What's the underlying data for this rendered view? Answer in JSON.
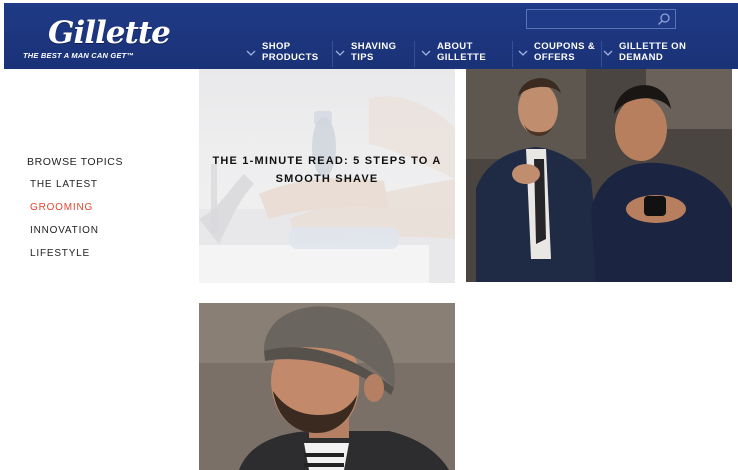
{
  "header": {
    "logo": "Gillette",
    "tagline": "THE BEST A MAN CAN GET™",
    "search_placeholder": "",
    "nav": [
      {
        "label": "SHOP\nPRODUCTS"
      },
      {
        "label": "SHAVING\nTIPS"
      },
      {
        "label": "ABOUT\nGILLETTE"
      },
      {
        "label": "COUPONS &\nOFFERS"
      },
      {
        "label": "GILLETTE ON\nDEMAND"
      }
    ]
  },
  "sidebar": {
    "heading": "BROWSE TOPICS",
    "topics": [
      {
        "label": "THE LATEST"
      },
      {
        "label": "GROOMING"
      },
      {
        "label": "INNOVATION"
      },
      {
        "label": "LIFESTYLE"
      }
    ]
  },
  "cards": [
    {
      "title": "THE 1-MINUTE READ: 5 STEPS TO A SMOOTH SHAVE"
    }
  ],
  "colors": {
    "brand": "#1f3a86",
    "active_topic": "#e0452c"
  }
}
